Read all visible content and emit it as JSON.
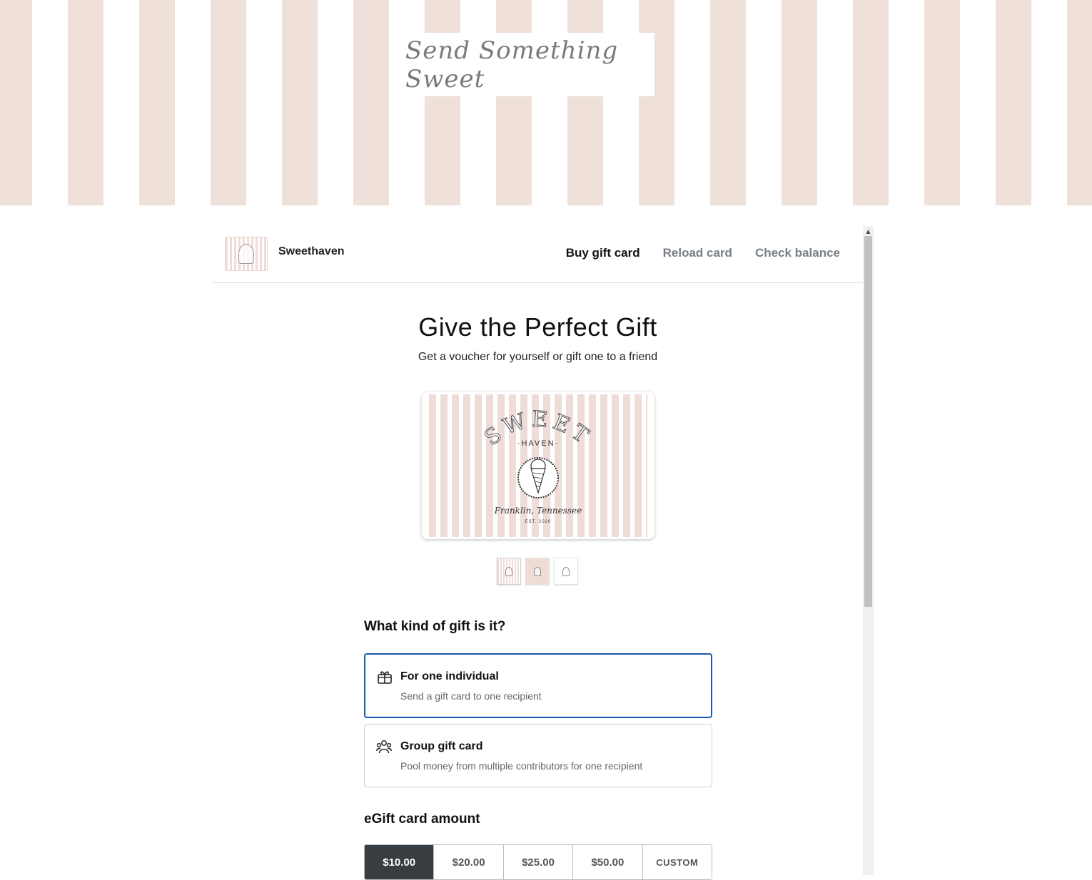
{
  "hero": {
    "title": "Send Something Sweet"
  },
  "header": {
    "brand": "Sweethaven",
    "nav": [
      {
        "label": "Buy gift card",
        "active": true
      },
      {
        "label": "Reload card",
        "active": false
      },
      {
        "label": "Check balance",
        "active": false
      }
    ]
  },
  "main": {
    "title": "Give the Perfect Gift",
    "subtitle": "Get a voucher for yourself or gift one to a friend"
  },
  "card_preview": {
    "logo_top": "SWEET",
    "logo_mid": "·HAVEN·",
    "logo_script": "Franklin, Tennessee",
    "logo_est": "EST. 2020",
    "design_count": 3
  },
  "gift_type": {
    "heading": "What kind of gift is it?",
    "options": [
      {
        "title": "For one individual",
        "desc": "Send a gift card to one recipient",
        "icon": "gift-icon",
        "selected": true
      },
      {
        "title": "Group gift card",
        "desc": "Pool money from multiple contributors for one recipient",
        "icon": "group-icon",
        "selected": false
      }
    ]
  },
  "amount": {
    "heading": "eGift card amount",
    "options": [
      "$10.00",
      "$20.00",
      "$25.00",
      "$50.00",
      "CUSTOM"
    ],
    "selected": "$10.00"
  },
  "colors": {
    "accent": "#1a58a8",
    "stripe": "#efdcd6",
    "selected_amount": "#383d42"
  }
}
